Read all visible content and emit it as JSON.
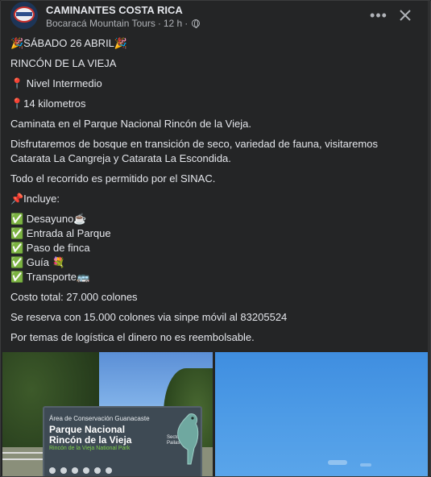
{
  "header": {
    "page_name": "CAMINANTES COSTA RICA",
    "meta_author": "Bocaracá Mountain Tours",
    "meta_separator": "·",
    "meta_time": "12 h",
    "meta_separator2": "·",
    "privacy_icon": "globe-icon",
    "more_icon": "more-horizontal-icon",
    "more_label": "•••",
    "close_icon": "close-icon"
  },
  "post": {
    "lines": [
      "🎉SÁBADO 26 ABRIL🎉",
      "RINCÓN DE LA VIEJA",
      "📍 Nivel Intermedio",
      "📍14 kilometros",
      "Caminata en el Parque Nacional Rincón de la Vieja.",
      "Disfrutaremos de bosque en transición de seco, variedad de fauna, visitaremos",
      "Catarata La Cangreja y Catarata La Escondida.",
      "Todo el recorrido es permitido por el SINAC.",
      "📌Incluye:",
      "✅ Desayuno☕",
      "✅ Entrada al Parque",
      "✅ Paso de finca",
      "✅ Guía 💐",
      "✅ Transporte🚌",
      "Costo total: 27.000 colones",
      "Se reserva con 15.000 colones via sinpe móvil al 83205524",
      "Por temas de logística el dinero no es reembolsable."
    ]
  },
  "photos": {
    "left": {
      "sign_area": "Área de Conservación Guanacaste",
      "sign_title_1": "Parque Nacional",
      "sign_title_2": "Rincón de la Vieja",
      "sign_english": "Rincón de la Vieja National Park",
      "sign_sector_1": "Sector",
      "sign_sector_2": "Pailas"
    },
    "right": {
      "description": ""
    }
  },
  "colors": {
    "background": "#242526",
    "text": "#e4e6eb",
    "secondary_text": "#b0b3b8",
    "sky": "#4d9be6"
  }
}
